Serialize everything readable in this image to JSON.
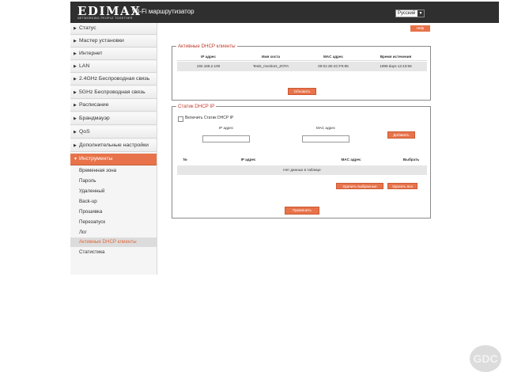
{
  "header": {
    "logo": "EDIMAX",
    "tagline": "NETWORKING PEOPLE TOGETHER",
    "title": "Wi-Fi маршрутизатор",
    "language": "Русский"
  },
  "sidebar": {
    "items": [
      {
        "label": "Статус"
      },
      {
        "label": "Мастер установки"
      },
      {
        "label": "Интернет"
      },
      {
        "label": "LAN"
      },
      {
        "label": "2.4GHz Беспроводная связь"
      },
      {
        "label": "5GHz Беспроводная связь"
      },
      {
        "label": "Расписание"
      },
      {
        "label": "Брандмауэр"
      },
      {
        "label": "QoS"
      },
      {
        "label": "Дополнительные настройки"
      },
      {
        "label": "Инструменты"
      }
    ],
    "subitems": [
      {
        "label": "Временная зона"
      },
      {
        "label": "Пароль"
      },
      {
        "label": "Удаленный"
      },
      {
        "label": "Back-up"
      },
      {
        "label": "Прошивка"
      },
      {
        "label": "Перезапуск"
      },
      {
        "label": "Лог"
      },
      {
        "label": "Активные DHCP клиенты"
      },
      {
        "label": "Статистика"
      }
    ]
  },
  "help_label": "Help",
  "active_dhcp": {
    "title": "Активные DHCP клиенты",
    "columns": [
      "IP адрес",
      "Имя хоста",
      "MAC адрес",
      "Время истечения"
    ],
    "row": [
      "192.168.2.100",
      "Tests_monitors_ZOTA",
      "00:01:2E:4C:F5:95",
      "1999 days 12:43:56"
    ],
    "refresh_label": "Обновить"
  },
  "static_dhcp": {
    "title": "Статик DHCP IP",
    "enable_label": "Включить Статик DHCP IP",
    "ip_label": "IP адрес",
    "mac_label": "MAC адрес",
    "ip_value": "",
    "mac_value": "",
    "add_label": "Добавить",
    "columns": [
      "№",
      "IP адрес",
      "MAC адрес",
      "Выбрать"
    ],
    "empty_text": "Нет данных в таблице",
    "delete_selected_label": "Удалить выбранные",
    "delete_all_label": "Удалить все"
  },
  "apply_label": "Применить",
  "watermark": "GDC"
}
